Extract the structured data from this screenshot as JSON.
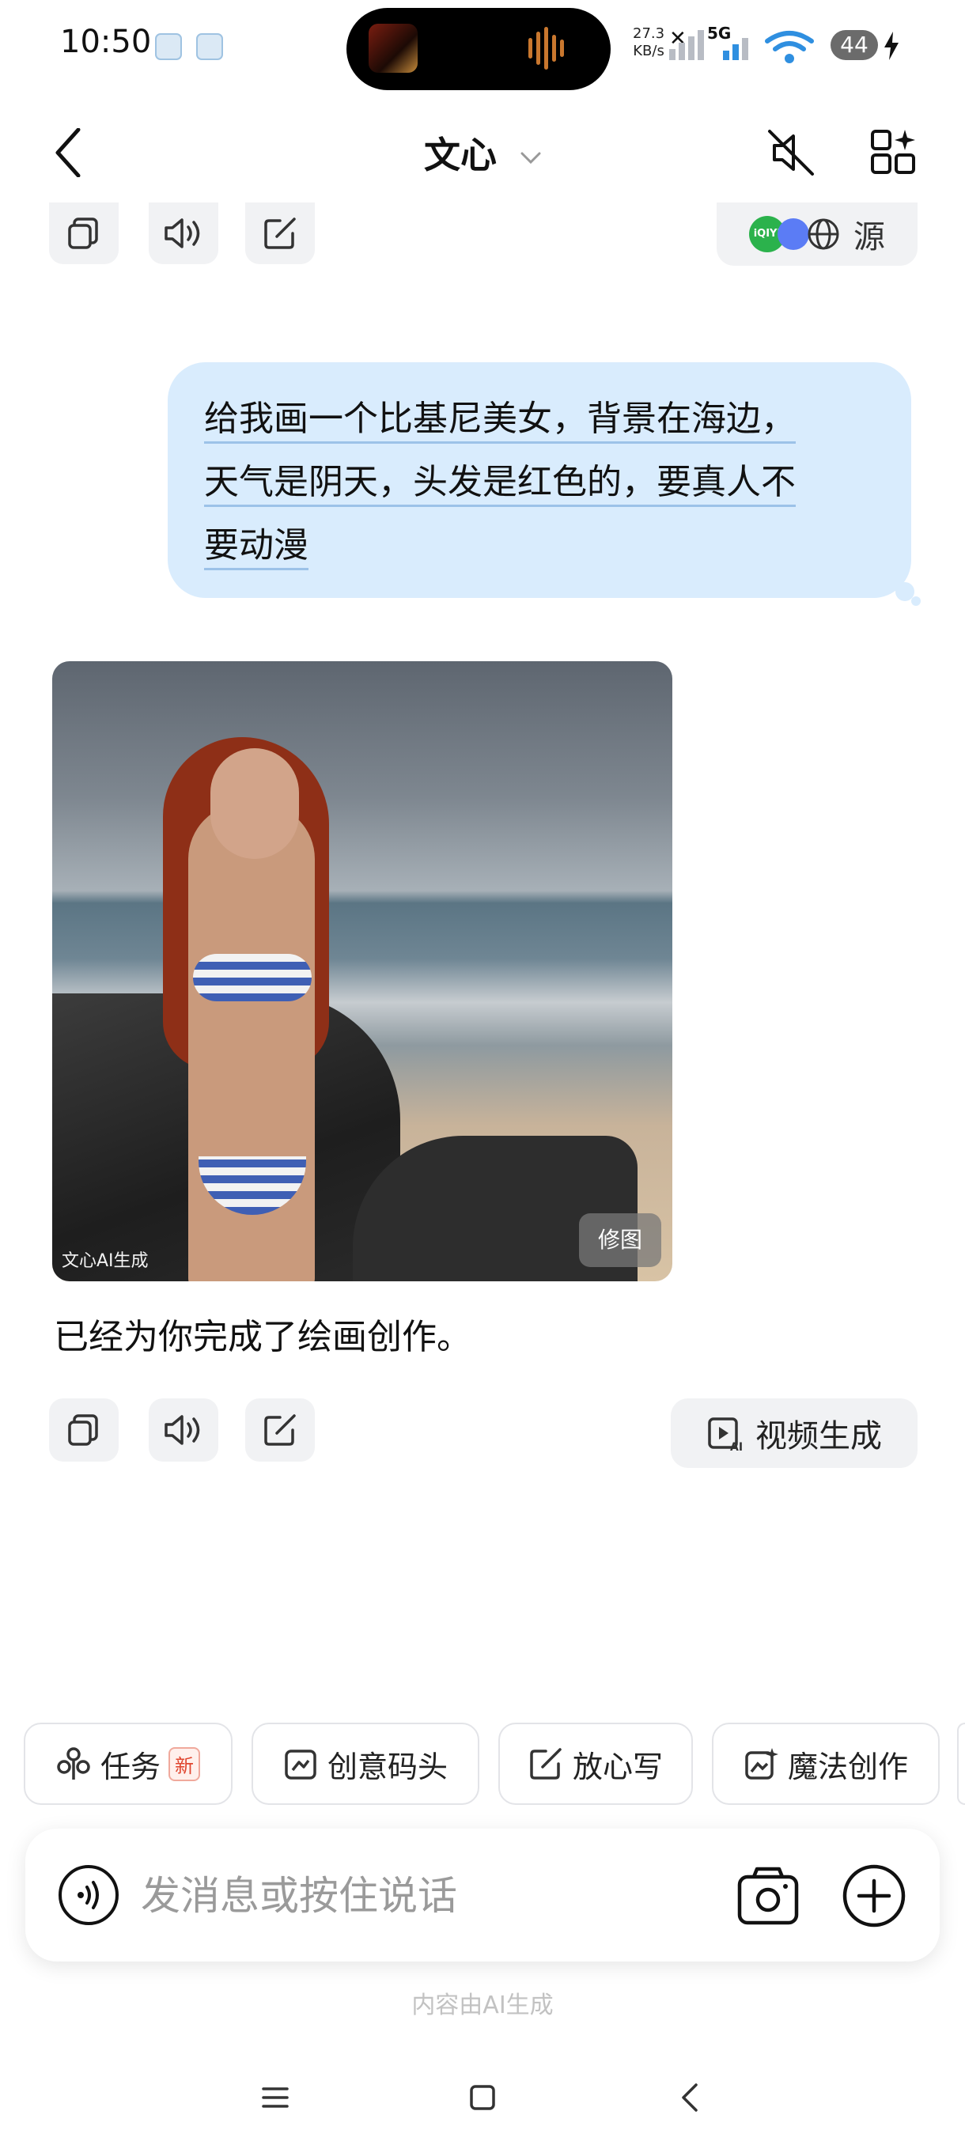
{
  "status_bar": {
    "time": "10:50",
    "net_speed_value": "27.3",
    "net_speed_unit": "KB/s",
    "network_label": "5G",
    "battery": "44"
  },
  "header": {
    "title": "文心"
  },
  "top_actions": {
    "source_label": "源",
    "iqiyi_label": "iQIYI"
  },
  "user_message": {
    "line1": "给我画一个比基尼美女，背景在海边，",
    "line2": "天气是阴天，头发是红色的，要真人不",
    "line3": "要动漫"
  },
  "generated_image": {
    "watermark": "文心AI生成",
    "edit_label": "修图"
  },
  "assistant_reply": "已经为你完成了绘画创作。",
  "bottom_actions": {
    "video_label": "视频生成"
  },
  "chips": [
    {
      "label": "任务",
      "badge": "新"
    },
    {
      "label": "创意码头"
    },
    {
      "label": "放心写"
    },
    {
      "label": "魔法创作"
    }
  ],
  "composer": {
    "placeholder": "发消息或按住说话"
  },
  "disclaimer": "内容由AI生成",
  "colors": {
    "bubble": "#d9ecfd",
    "chip_border": "#e3e4e8",
    "badge_red": "#e0462f"
  }
}
